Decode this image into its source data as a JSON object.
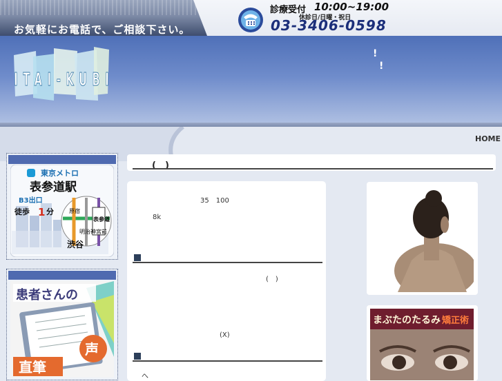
{
  "header": {
    "slogan": "お気軽にお電話で、ご相談下さい。",
    "hours_label": "診療受付",
    "hours_time": "10:00~19:00",
    "closed_days": "休診日/日曜・祝日",
    "phone": "03-3406-0598",
    "logo_text": "ITAI-KUBI",
    "banner_mark1": "!",
    "banner_mark2": "!"
  },
  "nav": {
    "home": "HOME"
  },
  "sidebar": {
    "station": {
      "operator": "東京メトロ",
      "station_name": "表参道駅",
      "exit": "B3出口",
      "walk_prefix": "徒歩",
      "walk_minutes": "1",
      "walk_unit": "分",
      "road_label": "明治神宮前",
      "street_left": "原宿",
      "street_right": "表参道",
      "station_bottom": "渋谷"
    },
    "testimonials": {
      "line1": "患者さんの",
      "line2": "直筆",
      "voice": "声"
    }
  },
  "main": {
    "title": "(　)",
    "text1": "35　100",
    "text2": "8k",
    "text3": "(　)",
    "text4": "(X)",
    "text5": "へ"
  },
  "photos": {
    "eye_caption_a": "まぶたのたるみ",
    "eye_caption_b": "矯正術"
  },
  "colors": {
    "accent": "#4f6ab0",
    "banner": "#5a78bf",
    "phone": "#1c2f7a"
  }
}
